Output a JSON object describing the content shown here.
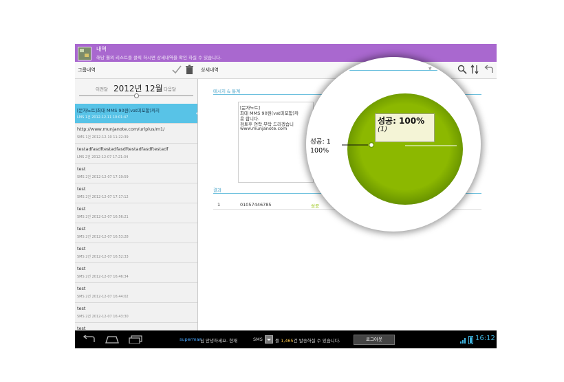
{
  "titlebar": {
    "title": "내역",
    "subtitle": "해당 월의 리스트를 클릭 하시면 상세내역을 확인 하실 수 있습니다."
  },
  "actionbar": {
    "group_label": "그룹내역",
    "detail_label": "상세내역",
    "icons": [
      "check-icon",
      "trash-icon",
      "search-icon",
      "sort-icon",
      "back-icon"
    ]
  },
  "month_nav": {
    "prev_label": "이전달",
    "current": "2012년 12월",
    "next_label": "다음달"
  },
  "messages": [
    {
      "title": "[문자노트]최대 MMS 90원(vat미포함)까지",
      "meta": "LMS 1건 2012-12-11 10:01:47"
    },
    {
      "title": "http://www.munjanote.com/urlplus/m1/",
      "meta": "SMS 1건 2012-12-10 11:22:39"
    },
    {
      "title": "testadfasdftestadfasdftestadfasdftestadf",
      "meta": "LMS 2건 2012-12-07 17:21:34"
    },
    {
      "title": "test",
      "meta": "SMS 2건 2012-12-07 17:19:59"
    },
    {
      "title": "test",
      "meta": "SMS 2건 2012-12-07 17:17:12"
    },
    {
      "title": "test",
      "meta": "SMS 2건 2012-12-07 16:56:21"
    },
    {
      "title": "test",
      "meta": "SMS 2건 2012-12-07 16:53:28"
    },
    {
      "title": "test",
      "meta": "SMS 2건 2012-12-07 16:52:33"
    },
    {
      "title": "test",
      "meta": "SMS 2건 2012-12-07 16:46:34"
    },
    {
      "title": "test",
      "meta": "SMS 2건 2012-12-07 16:44:02"
    },
    {
      "title": "test",
      "meta": "SMS 2건 2012-12-07 16:43:30"
    },
    {
      "title": "test",
      "meta": ""
    }
  ],
  "detail": {
    "section_message": "메시지 & 통계",
    "message_lines": [
      "[문자노트]",
      "최대 MMS 90원(vat미포함)까",
      "욧 합니다.",
      "검토후 연락 부탁 드리겠습니",
      "www.munjanote.com"
    ],
    "section_result": "결과",
    "result_row": {
      "index": "1",
      "phone": "01057446785",
      "status": "성공"
    }
  },
  "magnifier": {
    "corner_text": "ㅎ",
    "tooltip_main": "성공:  100%",
    "tooltip_count": "(1)",
    "label_line1": "성공: 1",
    "label_line2": "100%",
    "pie_color": "#8cb800"
  },
  "statusbar": {
    "user": "superman",
    "greeting": "님 안녕하세요. 현재",
    "sms_label": "SMS",
    "prefix": "를",
    "count": "1,465",
    "suffix": "건 발송하실 수 있습니다.",
    "logout": "로그아웃",
    "time": "16:12"
  },
  "chart_data": {
    "type": "pie",
    "categories": [
      "성공"
    ],
    "values": [
      1
    ],
    "percent": [
      100
    ],
    "colors": [
      "#8cb800"
    ]
  }
}
